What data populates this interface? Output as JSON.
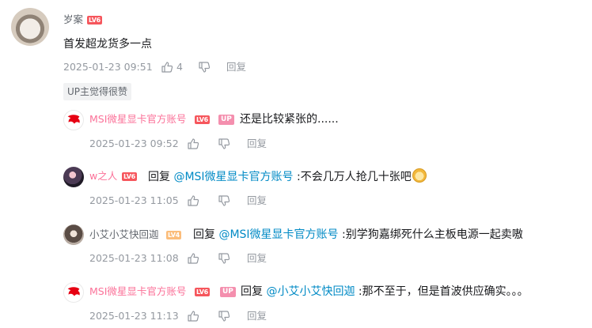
{
  "main_comment": {
    "username": "岁案",
    "level": "LV6",
    "text": "首发超龙货多一点",
    "time": "2025-01-23 09:51",
    "likes": "4",
    "reply_label": "回复",
    "tag": "UP主觉得很赞"
  },
  "replies": [
    {
      "username": "MSI微星显卡官方账号",
      "level": "LV6",
      "up_badge": "UP",
      "prefix": "",
      "mention": "",
      "text": "还是比较紧张的......",
      "time": "2025-01-23 09:52",
      "reply_label": "回复"
    },
    {
      "username": "w之人",
      "level": "LV6",
      "prefix": "回复 ",
      "mention": "@MSI微星显卡官方账号",
      "text": " :不会几万人抢几十张吧",
      "time": "2025-01-23 11:05",
      "reply_label": "回复"
    },
    {
      "username": "小艾小艾快回迦",
      "level": "LV4",
      "prefix": "回复 ",
      "mention": "@MSI微星显卡官方账号",
      "text": " :别学狗嘉绑死什么主板电源一起卖嗷",
      "time": "2025-01-23 11:08",
      "reply_label": "回复"
    },
    {
      "username": "MSI微星显卡官方账号",
      "level": "LV6",
      "up_badge": "UP",
      "prefix": "回复 ",
      "mention": "@小艾小艾快回迦",
      "text": " :那不至于，但是首波供应确实。。。",
      "time": "2025-01-23 11:13",
      "reply_label": "回复"
    }
  ],
  "colors": {
    "accent_pink": "#fb7299",
    "mention_blue": "#008ac5",
    "level_red": "#f6565c",
    "level_orange": "#fbbd7b",
    "msi_red": "#e60012"
  },
  "icons": [
    "thumbs-up-icon",
    "thumbs-down-icon",
    "msi-dragon-icon",
    "emoji-icon"
  ]
}
